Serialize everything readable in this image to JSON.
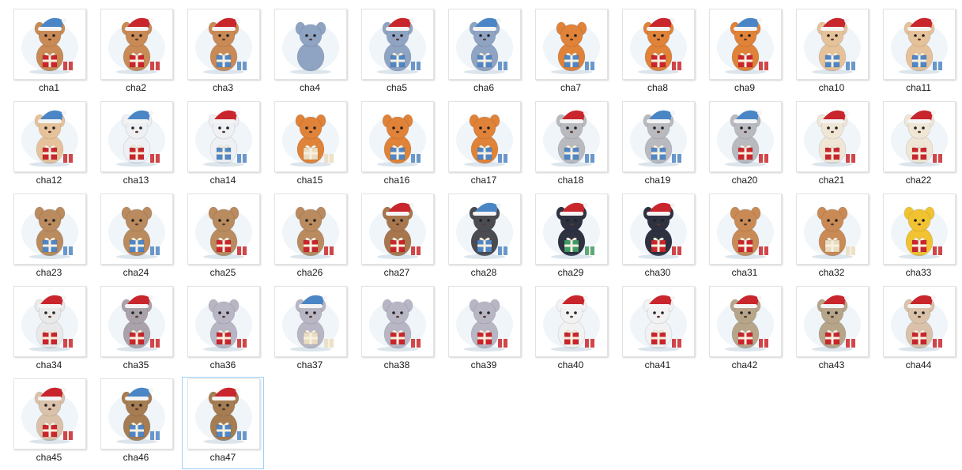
{
  "files": [
    {
      "name": "cha1",
      "animal": "deer",
      "hat": "blue",
      "gift": "red"
    },
    {
      "name": "cha2",
      "animal": "deer",
      "hat": "red",
      "gift": "red"
    },
    {
      "name": "cha3",
      "animal": "deer",
      "hat": "red",
      "gift": "blue"
    },
    {
      "name": "cha4",
      "animal": "elephant",
      "hat": "none",
      "gift": "none"
    },
    {
      "name": "cha5",
      "animal": "elephant",
      "hat": "red",
      "gift": "blue"
    },
    {
      "name": "cha6",
      "animal": "elephant",
      "hat": "blue",
      "gift": "blue"
    },
    {
      "name": "cha7",
      "animal": "fox",
      "hat": "none",
      "gift": "blue"
    },
    {
      "name": "cha8",
      "animal": "fox",
      "hat": "red",
      "gift": "red"
    },
    {
      "name": "cha9",
      "animal": "fox",
      "hat": "blue",
      "gift": "red"
    },
    {
      "name": "cha10",
      "animal": "hamster",
      "hat": "red",
      "gift": "blue"
    },
    {
      "name": "cha11",
      "animal": "hamster",
      "hat": "red",
      "gift": "blue"
    },
    {
      "name": "cha12",
      "animal": "hamster",
      "hat": "blue",
      "gift": "red"
    },
    {
      "name": "cha13",
      "animal": "lamb",
      "hat": "blue",
      "gift": "red"
    },
    {
      "name": "cha14",
      "animal": "lamb",
      "hat": "red",
      "gift": "blue"
    },
    {
      "name": "cha15",
      "animal": "fox",
      "hat": "none",
      "gift": "cream"
    },
    {
      "name": "cha16",
      "animal": "fox",
      "hat": "none",
      "gift": "blue"
    },
    {
      "name": "cha17",
      "animal": "fox",
      "hat": "none",
      "gift": "blue"
    },
    {
      "name": "cha18",
      "animal": "cat",
      "hat": "red",
      "gift": "blue"
    },
    {
      "name": "cha19",
      "animal": "cat",
      "hat": "blue",
      "gift": "blue"
    },
    {
      "name": "cha20",
      "animal": "cat",
      "hat": "blue",
      "gift": "red"
    },
    {
      "name": "cha21",
      "animal": "sheep",
      "hat": "red",
      "gift": "red"
    },
    {
      "name": "cha22",
      "animal": "sheep",
      "hat": "red",
      "gift": "red"
    },
    {
      "name": "cha23",
      "animal": "bear",
      "hat": "none",
      "gift": "blue"
    },
    {
      "name": "cha24",
      "animal": "bear",
      "hat": "none",
      "gift": "blue"
    },
    {
      "name": "cha25",
      "animal": "bear",
      "hat": "none",
      "gift": "red"
    },
    {
      "name": "cha26",
      "animal": "bear",
      "hat": "none",
      "gift": "red"
    },
    {
      "name": "cha27",
      "animal": "monkey",
      "hat": "red",
      "gift": "red"
    },
    {
      "name": "cha28",
      "animal": "gorilla",
      "hat": "blue",
      "gift": "blue"
    },
    {
      "name": "cha29",
      "animal": "penguin",
      "hat": "red",
      "gift": "green"
    },
    {
      "name": "cha30",
      "animal": "penguin",
      "hat": "red",
      "gift": "red"
    },
    {
      "name": "cha31",
      "animal": "deer",
      "hat": "none",
      "gift": "red"
    },
    {
      "name": "cha32",
      "animal": "deer",
      "hat": "none",
      "gift": "cream"
    },
    {
      "name": "cha33",
      "animal": "bee",
      "hat": "none",
      "gift": "red"
    },
    {
      "name": "cha34",
      "animal": "zebra",
      "hat": "red",
      "gift": "red"
    },
    {
      "name": "cha35",
      "animal": "hippo",
      "hat": "red",
      "gift": "red"
    },
    {
      "name": "cha36",
      "animal": "mouse",
      "hat": "none",
      "gift": "red"
    },
    {
      "name": "cha37",
      "animal": "mouse",
      "hat": "blue",
      "gift": "cream"
    },
    {
      "name": "cha38",
      "animal": "mouse",
      "hat": "none",
      "gift": "red"
    },
    {
      "name": "cha39",
      "animal": "mouse",
      "hat": "none",
      "gift": "red"
    },
    {
      "name": "cha40",
      "animal": "panda",
      "hat": "red",
      "gift": "red"
    },
    {
      "name": "cha41",
      "animal": "panda",
      "hat": "red",
      "gift": "red"
    },
    {
      "name": "cha42",
      "animal": "hedgehog",
      "hat": "red",
      "gift": "red"
    },
    {
      "name": "cha43",
      "animal": "hedgehog",
      "hat": "red",
      "gift": "red"
    },
    {
      "name": "cha44",
      "animal": "bunny",
      "hat": "red",
      "gift": "red"
    },
    {
      "name": "cha45",
      "animal": "bunny",
      "hat": "red",
      "gift": "red"
    },
    {
      "name": "cha46",
      "animal": "puppy",
      "hat": "blue",
      "gift": "blue"
    },
    {
      "name": "cha47",
      "animal": "puppy",
      "hat": "red",
      "gift": "blue",
      "selected": true
    }
  ],
  "colors": {
    "selection_border": "#99d1ff",
    "label_text": "#1a1a1a",
    "hat_red": "#c8262c",
    "hat_blue": "#4a86c5",
    "gift_red": "#c9262c",
    "gift_blue": "#4f86c6",
    "gift_green": "#3f9a63",
    "gift_cream": "#e9dcc0"
  },
  "animal_colors": {
    "deer": "#c98a55",
    "elephant": "#8fa3c2",
    "fox": "#e08238",
    "hamster": "#e6c29a",
    "lamb": "#eef0f4",
    "cat": "#b9b9c0",
    "sheep": "#efe6d6",
    "bear": "#b98b5e",
    "monkey": "#a8764d",
    "gorilla": "#4b4b52",
    "penguin": "#2d3140",
    "bee": "#f1c232",
    "zebra": "#e9e9e9",
    "hippo": "#a9a2ab",
    "mouse": "#b8b6c4",
    "panda": "#f2f2f2",
    "hedgehog": "#b7a58a",
    "bunny": "#d9c2a9",
    "puppy": "#a67c52"
  }
}
